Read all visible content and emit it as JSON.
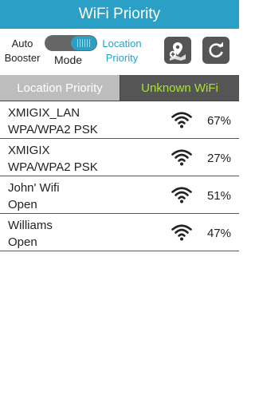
{
  "app": {
    "title": "WiFi Priority"
  },
  "controls": {
    "auto_booster_label": "Auto\nBooster",
    "mode_label": "Mode",
    "location_priority_label": "Location\nPriority",
    "toggle_state": "location-priority",
    "add_location_icon": "map-pin-add-icon",
    "refresh_icon": "refresh-icon"
  },
  "tabs": [
    {
      "label": "Location Priority",
      "active": false
    },
    {
      "label": "Unknown WiFi",
      "active": true
    }
  ],
  "networks": [
    {
      "name": "XMIGIX_LAN",
      "security": "WPA/WPA2 PSK",
      "signal": "67%"
    },
    {
      "name": "XMIGIX",
      "security": "WPA/WPA2 PSK",
      "signal": "27%"
    },
    {
      "name": "John' Wifi",
      "security": "Open",
      "signal": "51%"
    },
    {
      "name": "Williams",
      "security": "Open",
      "signal": "47%"
    }
  ],
  "colors": {
    "accent": "#2ba0c7",
    "active_tab_text": "#a7e52c",
    "tab_inactive_bg": "#bdbdbd",
    "tab_active_bg": "#555555"
  }
}
